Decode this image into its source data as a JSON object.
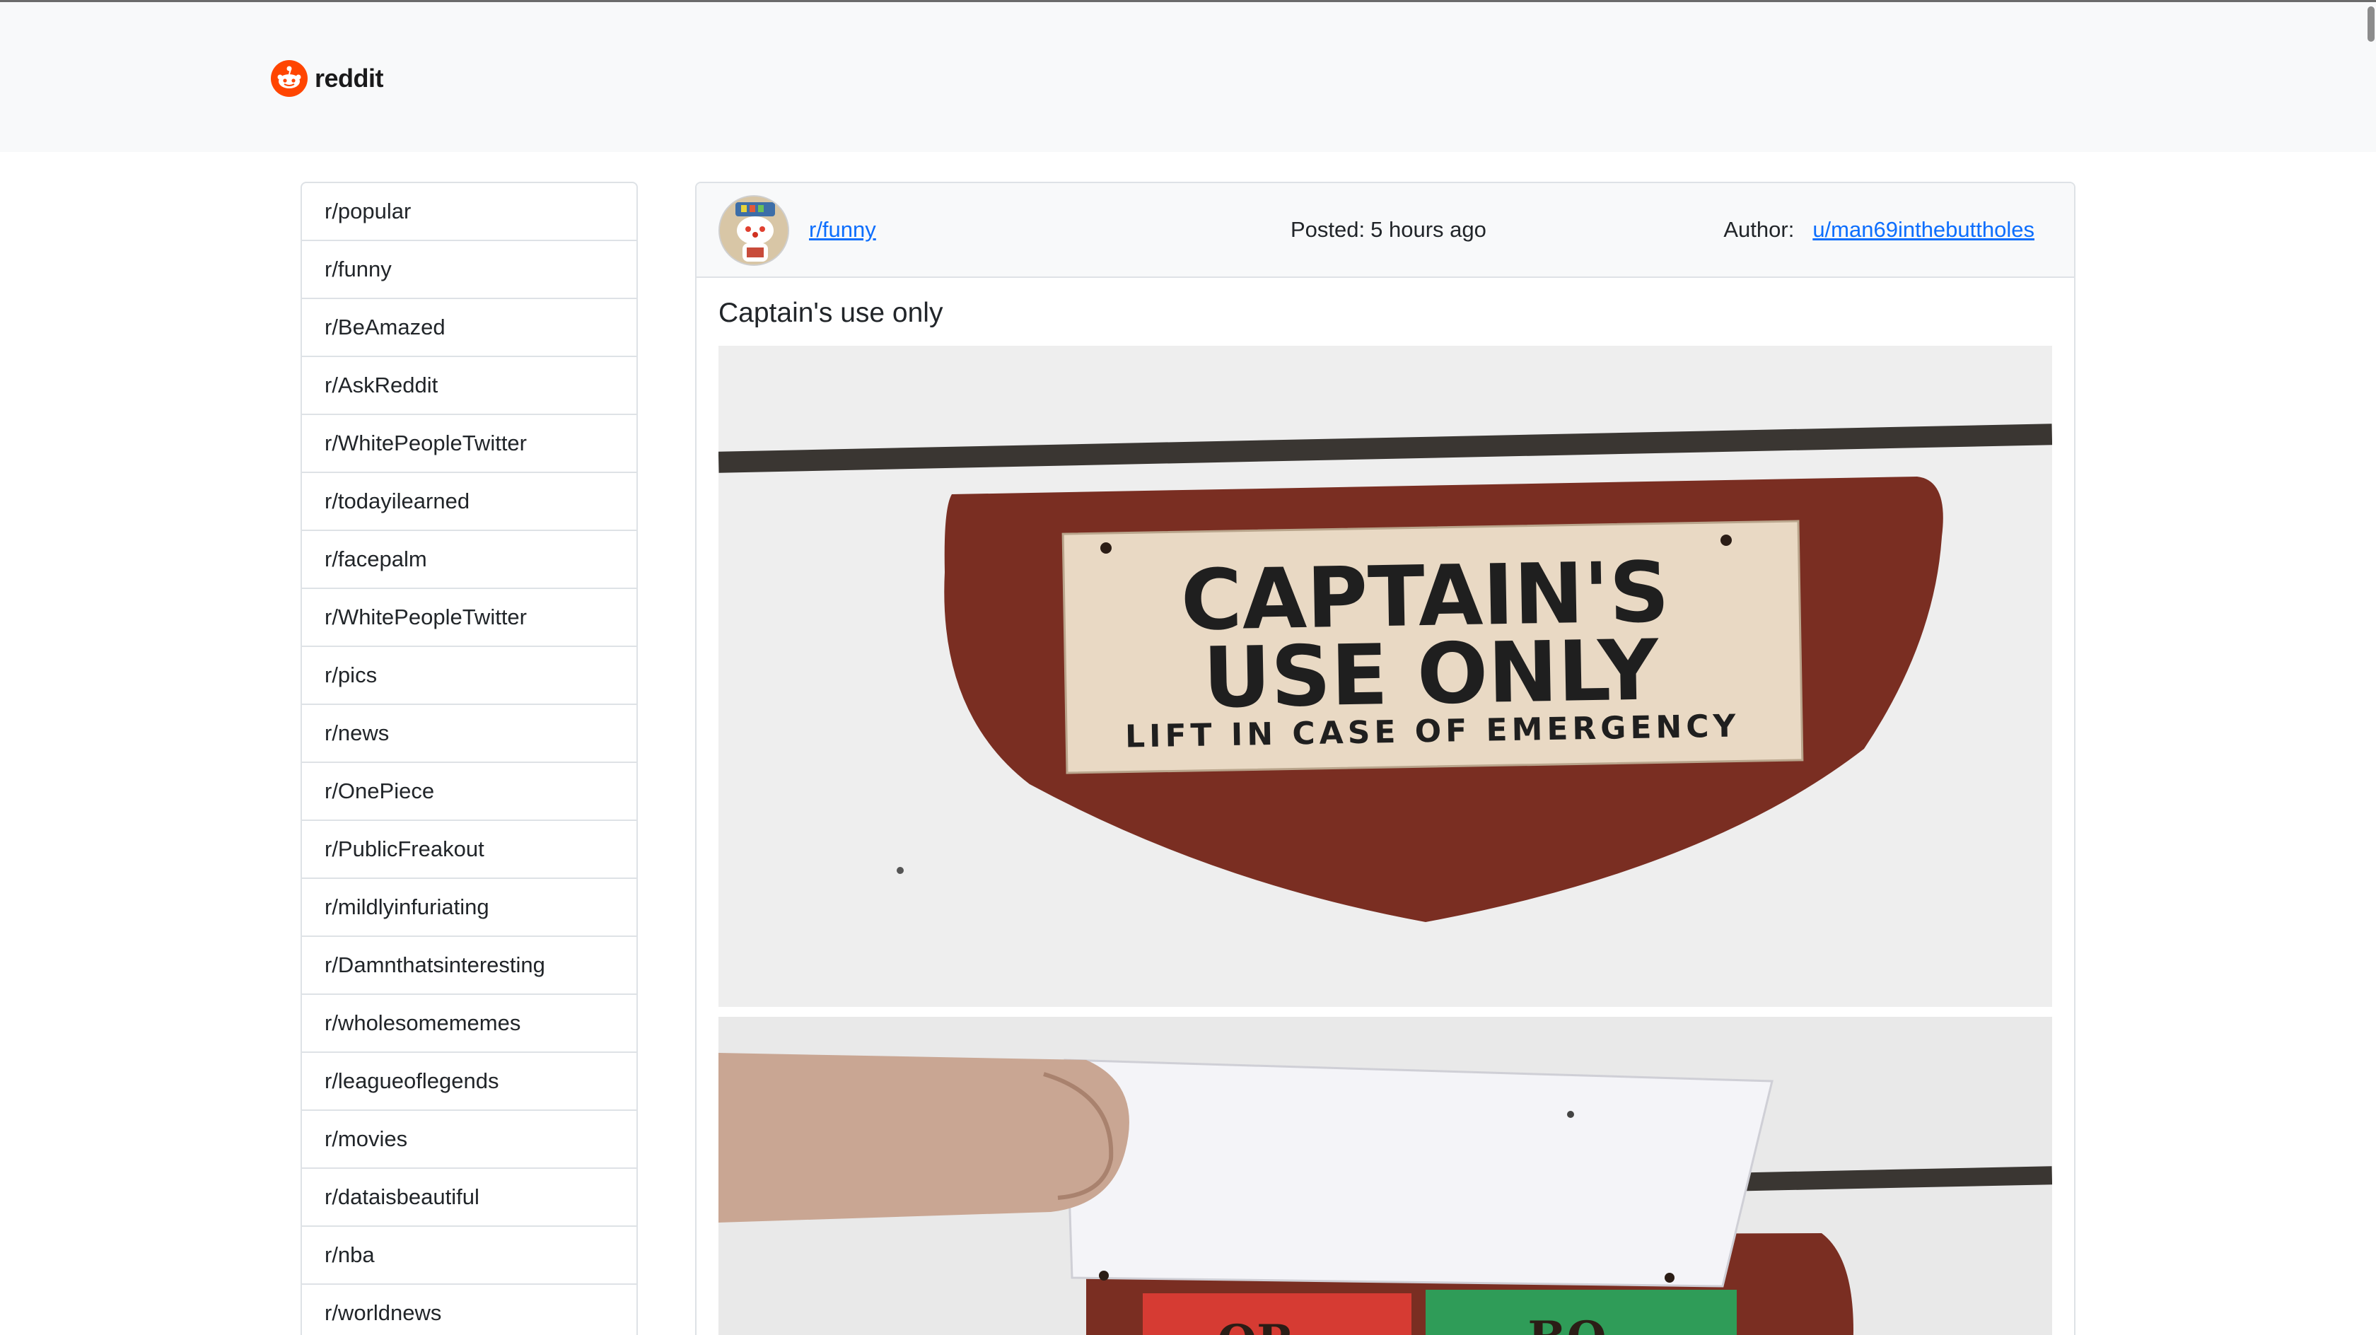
{
  "header": {
    "logo_text": "reddit",
    "logo_icon": "reddit-alien-icon",
    "brand_color": "#ff4500"
  },
  "sidebar": {
    "items": [
      {
        "label": "r/popular"
      },
      {
        "label": "r/funny"
      },
      {
        "label": "r/BeAmazed"
      },
      {
        "label": "r/AskReddit"
      },
      {
        "label": "r/WhitePeopleTwitter"
      },
      {
        "label": "r/todayilearned"
      },
      {
        "label": "r/facepalm"
      },
      {
        "label": "r/WhitePeopleTwitter"
      },
      {
        "label": "r/pics"
      },
      {
        "label": "r/news"
      },
      {
        "label": "r/OnePiece"
      },
      {
        "label": "r/PublicFreakout"
      },
      {
        "label": "r/mildlyinfuriating"
      },
      {
        "label": "r/Damnthatsinteresting"
      },
      {
        "label": "r/wholesomememes"
      },
      {
        "label": "r/leagueoflegends"
      },
      {
        "label": "r/movies"
      },
      {
        "label": "r/dataisbeautiful"
      },
      {
        "label": "r/nba"
      },
      {
        "label": "r/worldnews"
      }
    ]
  },
  "post": {
    "subreddit": "r/funny",
    "posted_label": "Posted:",
    "posted_time": "5 hours ago",
    "author_label": "Author:",
    "author": "u/man69inthebuttholes",
    "title": "Captain's use only",
    "image": {
      "sign_line1": "CAPTAIN'S",
      "sign_line2": "USE ONLY",
      "sign_line3": "LIFT IN CASE OF EMERGENCY",
      "lower_left": "OR",
      "lower_right": "BO"
    },
    "link_color": "#0d6efd"
  }
}
